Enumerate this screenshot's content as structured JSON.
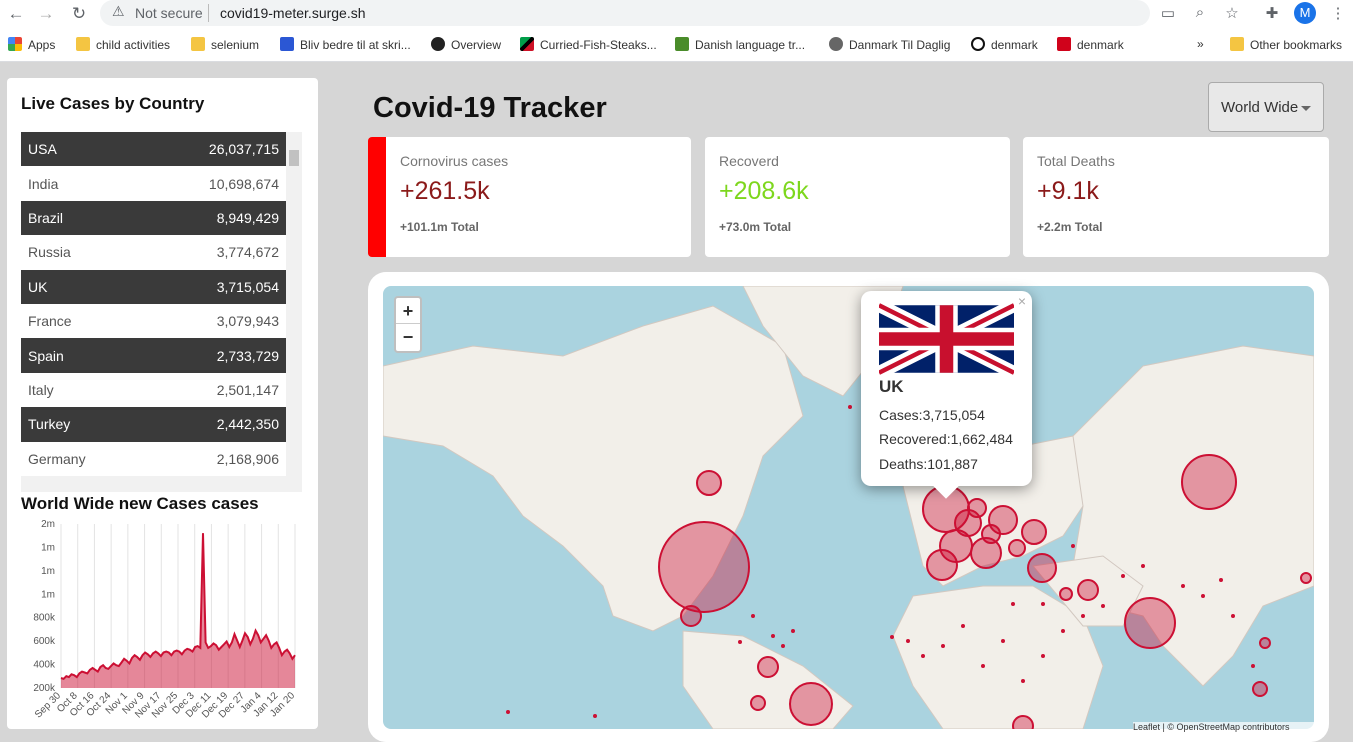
{
  "browser": {
    "security": "Not secure",
    "url": "covid19-meter.surge.sh",
    "profile_initial": "M",
    "bookmarks": [
      {
        "label": "Apps"
      },
      {
        "label": "child activities"
      },
      {
        "label": "selenium"
      },
      {
        "label": "Bliv bedre til at skri..."
      },
      {
        "label": "Overview"
      },
      {
        "label": "Curried-Fish-Steaks..."
      },
      {
        "label": "Danish language tr..."
      },
      {
        "label": "Danmark Til Daglig"
      },
      {
        "label": "denmark"
      },
      {
        "label": "denmark"
      },
      {
        "label": "Other bookmarks"
      }
    ],
    "more_bookmarks": "»"
  },
  "sidebar": {
    "title": "Live Cases by Country",
    "countries": [
      {
        "name": "USA",
        "cases": "26,037,715"
      },
      {
        "name": "India",
        "cases": "10,698,674"
      },
      {
        "name": "Brazil",
        "cases": "8,949,429"
      },
      {
        "name": "Russia",
        "cases": "3,774,672"
      },
      {
        "name": "UK",
        "cases": "3,715,054"
      },
      {
        "name": "France",
        "cases": "3,079,943"
      },
      {
        "name": "Spain",
        "cases": "2,733,729"
      },
      {
        "name": "Italy",
        "cases": "2,501,147"
      },
      {
        "name": "Turkey",
        "cases": "2,442,350"
      },
      {
        "name": "Germany",
        "cases": "2,168,906"
      }
    ],
    "chart_title": "World Wide new Cases cases"
  },
  "chart_data": {
    "type": "area",
    "title": "World Wide new Cases cases",
    "y_ticks": [
      "2m",
      "1m",
      "1m",
      "1m",
      "800k",
      "600k",
      "400k",
      "200k"
    ],
    "x_ticks": [
      "Sep 30",
      "Oct 8",
      "Oct 16",
      "Oct 24",
      "Nov 1",
      "Nov 9",
      "Nov 17",
      "Nov 25",
      "Dec 3",
      "Dec 11",
      "Dec 19",
      "Dec 27",
      "Jan 4",
      "Jan 12",
      "Jan 20"
    ],
    "ylim": [
      200000,
      2000000
    ],
    "color": "#cc1034",
    "values": [
      310000,
      300000,
      330000,
      320000,
      350000,
      340000,
      320000,
      360000,
      380000,
      370000,
      360000,
      400000,
      420000,
      400000,
      380000,
      430000,
      450000,
      420000,
      410000,
      440000,
      470000,
      450000,
      440000,
      480000,
      520000,
      500000,
      470000,
      530000,
      560000,
      540000,
      510000,
      560000,
      590000,
      570000,
      540000,
      580000,
      600000,
      580000,
      550000,
      590000,
      600000,
      590000,
      560000,
      600000,
      610000,
      600000,
      570000,
      610000,
      630000,
      620000,
      600000,
      650000,
      660000,
      640000,
      1900000,
      700000,
      640000,
      660000,
      690000,
      670000,
      620000,
      650000,
      680000,
      710000,
      650000,
      700000,
      790000,
      720000,
      650000,
      720000,
      800000,
      760000,
      680000,
      740000,
      830000,
      780000,
      700000,
      740000,
      780000,
      720000,
      640000,
      680000,
      700000,
      640000,
      560000,
      600000,
      620000,
      580000,
      520000,
      560000
    ]
  },
  "header": {
    "title": "Covid-19 Tracker",
    "region": "World Wide"
  },
  "stats": {
    "cases": {
      "label": "Cornovirus cases",
      "value": "+261.5k",
      "total": "+101.1m Total"
    },
    "recovered": {
      "label": "Recoverd",
      "value": "+208.6k",
      "total": "+73.0m Total"
    },
    "deaths": {
      "label": "Total Deaths",
      "value": "+9.1k",
      "total": "+2.2m Total"
    }
  },
  "colors": {
    "cases_accent": "#ff0000",
    "cases_value": "#8b1a1a",
    "recovered_value": "#7dd71d",
    "deaths_value": "#8b1a1a",
    "map_circle": "#cc1034"
  },
  "map": {
    "zoom_in": "+",
    "zoom_out": "−",
    "popup": {
      "country": "UK",
      "cases": "Cases:3,715,054",
      "recovered": "Recovered:1,662,484",
      "deaths": "Deaths:101,887",
      "close": "×"
    },
    "attribution": "Leaflet | © OpenStreetMap contributors"
  }
}
